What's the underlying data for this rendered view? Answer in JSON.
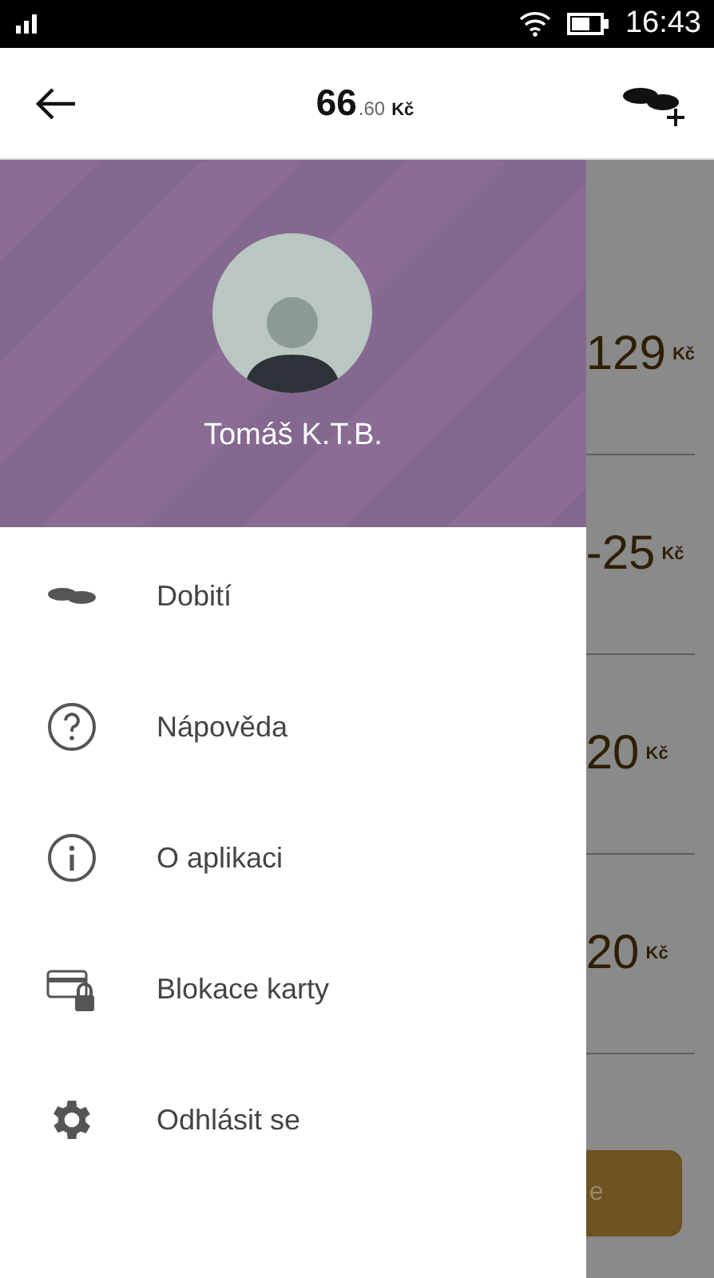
{
  "status_bar": {
    "time": "16:43"
  },
  "app_bar": {
    "balance_main": "66",
    "balance_decimal": ".60",
    "currency": "Kč"
  },
  "drawer": {
    "user_name": "Tomáš K.T.B.",
    "items": [
      {
        "kind": "coins",
        "label": "Dobití"
      },
      {
        "kind": "help",
        "label": "Nápověda"
      },
      {
        "kind": "info",
        "label": "O aplikaci"
      },
      {
        "kind": "card-lock",
        "label": "Blokace karty"
      },
      {
        "kind": "gear",
        "label": "Odhlásit se"
      }
    ]
  },
  "background_list": {
    "rows": [
      {
        "amount": "129",
        "currency": "Kč"
      },
      {
        "amount": "-25",
        "currency": "Kč"
      },
      {
        "amount": "20",
        "currency": "Kč"
      },
      {
        "amount": "20",
        "currency": "Kč"
      }
    ],
    "button_label": "e"
  }
}
